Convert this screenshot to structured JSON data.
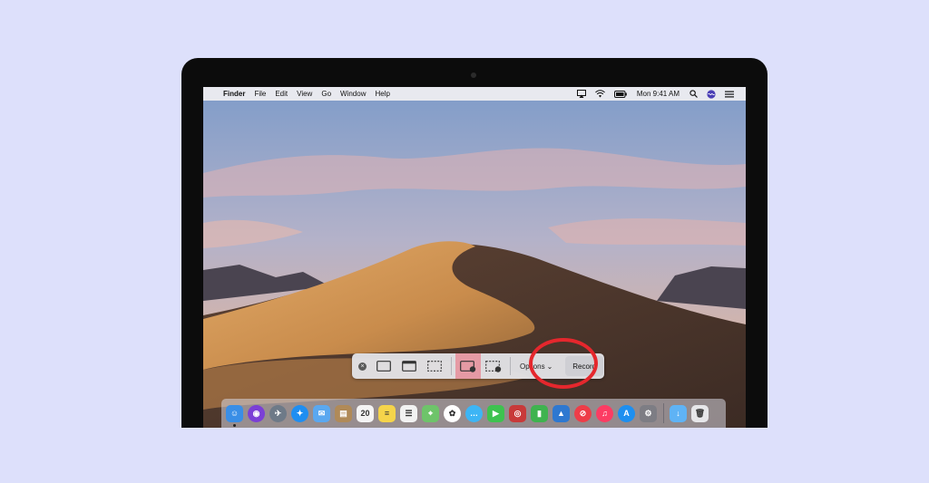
{
  "menubar": {
    "apple_glyph": "",
    "app_name": "Finder",
    "menus": [
      "File",
      "Edit",
      "View",
      "Go",
      "Window",
      "Help"
    ],
    "clock": "Mon 9:41 AM",
    "status_icons": [
      "airplay-icon",
      "wifi-icon",
      "battery-icon",
      "spotlight-search-icon",
      "siri-icon",
      "menu-list-icon"
    ]
  },
  "capture_toolbar": {
    "close_glyph": "×",
    "tools": [
      {
        "name": "capture-entire-screen",
        "active": false
      },
      {
        "name": "capture-selected-window",
        "active": false
      },
      {
        "name": "capture-selected-portion",
        "active": false
      },
      {
        "name": "record-entire-screen",
        "active": true
      },
      {
        "name": "record-selected-portion",
        "active": false
      }
    ],
    "options_label": "Options",
    "options_chevron": "⌄",
    "record_label": "Record"
  },
  "dock": {
    "apps": [
      {
        "name": "finder",
        "bg": "#3a8ee6",
        "glyph": "☺",
        "running": true
      },
      {
        "name": "siri",
        "bg": "#7b3fd6",
        "glyph": "◉",
        "round": true
      },
      {
        "name": "launchpad",
        "bg": "#6e7a88",
        "glyph": "✈",
        "round": true
      },
      {
        "name": "safari",
        "bg": "#1f8ef1",
        "glyph": "✦",
        "round": true
      },
      {
        "name": "mail",
        "bg": "#5aa8f0",
        "glyph": "✉"
      },
      {
        "name": "contacts",
        "bg": "#b08a58",
        "glyph": "▤"
      },
      {
        "name": "calendar",
        "bg": "#f4f4f4",
        "glyph": "20",
        "dark": true
      },
      {
        "name": "notes",
        "bg": "#f5d44a",
        "glyph": "≡",
        "dark": true
      },
      {
        "name": "reminders",
        "bg": "#f2f2f2",
        "glyph": "☰",
        "dark": true
      },
      {
        "name": "maps",
        "bg": "#6ec46a",
        "glyph": "⌖"
      },
      {
        "name": "photos",
        "bg": "#ffffff",
        "glyph": "✿",
        "dark": true,
        "round": true
      },
      {
        "name": "messages",
        "bg": "#3db5f5",
        "glyph": "…",
        "round": true
      },
      {
        "name": "facetime",
        "bg": "#3ec24f",
        "glyph": "▶"
      },
      {
        "name": "photo-booth",
        "bg": "#c83a3a",
        "glyph": "◎"
      },
      {
        "name": "numbers",
        "bg": "#3fb34f",
        "glyph": "▮"
      },
      {
        "name": "keynote",
        "bg": "#2e78d0",
        "glyph": "▲"
      },
      {
        "name": "news",
        "bg": "#ee3d48",
        "glyph": "⊘",
        "round": true
      },
      {
        "name": "music",
        "bg": "#fc3c63",
        "glyph": "♫",
        "round": true
      },
      {
        "name": "app-store",
        "bg": "#1d8ff0",
        "glyph": "A",
        "round": true
      },
      {
        "name": "system-preferences",
        "bg": "#7d7d84",
        "glyph": "⚙"
      }
    ],
    "extras": [
      {
        "name": "downloads-folder",
        "bg": "#5fb3f5",
        "glyph": "↓"
      },
      {
        "name": "trash",
        "bg": "#e6e6e9",
        "glyph": "🗑",
        "dark": true
      }
    ]
  }
}
